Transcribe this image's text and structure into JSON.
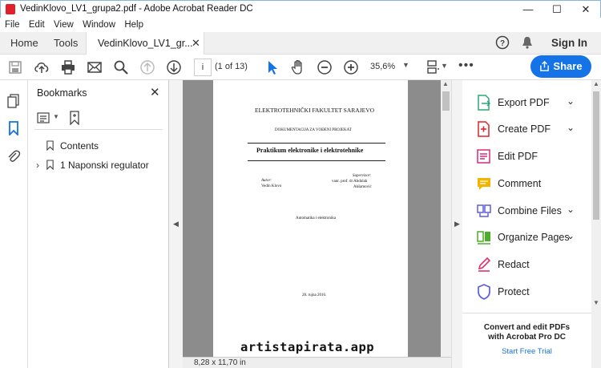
{
  "window": {
    "title": "VedinKlovo_LV1_grupa2.pdf - Adobe Acrobat Reader DC",
    "min": "—",
    "max": "☐",
    "close": "✕"
  },
  "menu": [
    "File",
    "Edit",
    "View",
    "Window",
    "Help"
  ],
  "tabs": {
    "home": "Home",
    "tools": "Tools",
    "doc": "VedinKlovo_LV1_gr...",
    "doc_close": "✕",
    "sign_in": "Sign In"
  },
  "toolbar": {
    "page_value": "i",
    "page_count": "(1 of 13)",
    "zoom": "35,6%",
    "share": "Share"
  },
  "bookmarks": {
    "title": "Bookmarks",
    "items": [
      "Contents",
      "1 Naponski regulator"
    ]
  },
  "page": {
    "faculty": "ELEKTROTEHNIČKI FAKULTET SARAJEVO",
    "doc_type": "DOKUMENTACIJA ZA VOĐENI PROJEKAT",
    "title": "Praktikum elektronike i elektrotehnike",
    "author_label": "Autor:",
    "author": "Vedin Klovo",
    "supervisor_label": "Supervizor:",
    "supervisor": "vanr. prof. dr Abdulah",
    "supervisor2": "Akšamović",
    "dept": "Automatika i elektronika",
    "date": "28. rujna 2016."
  },
  "status": {
    "dimensions": "8,28 x 11,70 in"
  },
  "watermark": "artistapirata.app",
  "tools_pane": [
    {
      "label": "Export PDF",
      "icon": "export-pdf-icon",
      "color": "#2ba876",
      "chevron": true
    },
    {
      "label": "Create PDF",
      "icon": "create-pdf-icon",
      "color": "#e0202a",
      "chevron": true
    },
    {
      "label": "Edit PDF",
      "icon": "edit-pdf-icon",
      "color": "#d62a7d",
      "chevron": false
    },
    {
      "label": "Comment",
      "icon": "comment-icon",
      "color": "#f3b400",
      "chevron": false
    },
    {
      "label": "Combine Files",
      "icon": "combine-files-icon",
      "color": "#5b5ddb",
      "chevron": true
    },
    {
      "label": "Organize Pages",
      "icon": "organize-pages-icon",
      "color": "#4caf2a",
      "chevron": true
    },
    {
      "label": "Redact",
      "icon": "redact-icon",
      "color": "#e0306a",
      "chevron": false
    },
    {
      "label": "Protect",
      "icon": "protect-icon",
      "color": "#5b5ddb",
      "chevron": false
    }
  ],
  "promo": {
    "line1": "Convert and edit PDFs",
    "line2": "with Acrobat Pro DC",
    "link": "Start Free Trial"
  }
}
